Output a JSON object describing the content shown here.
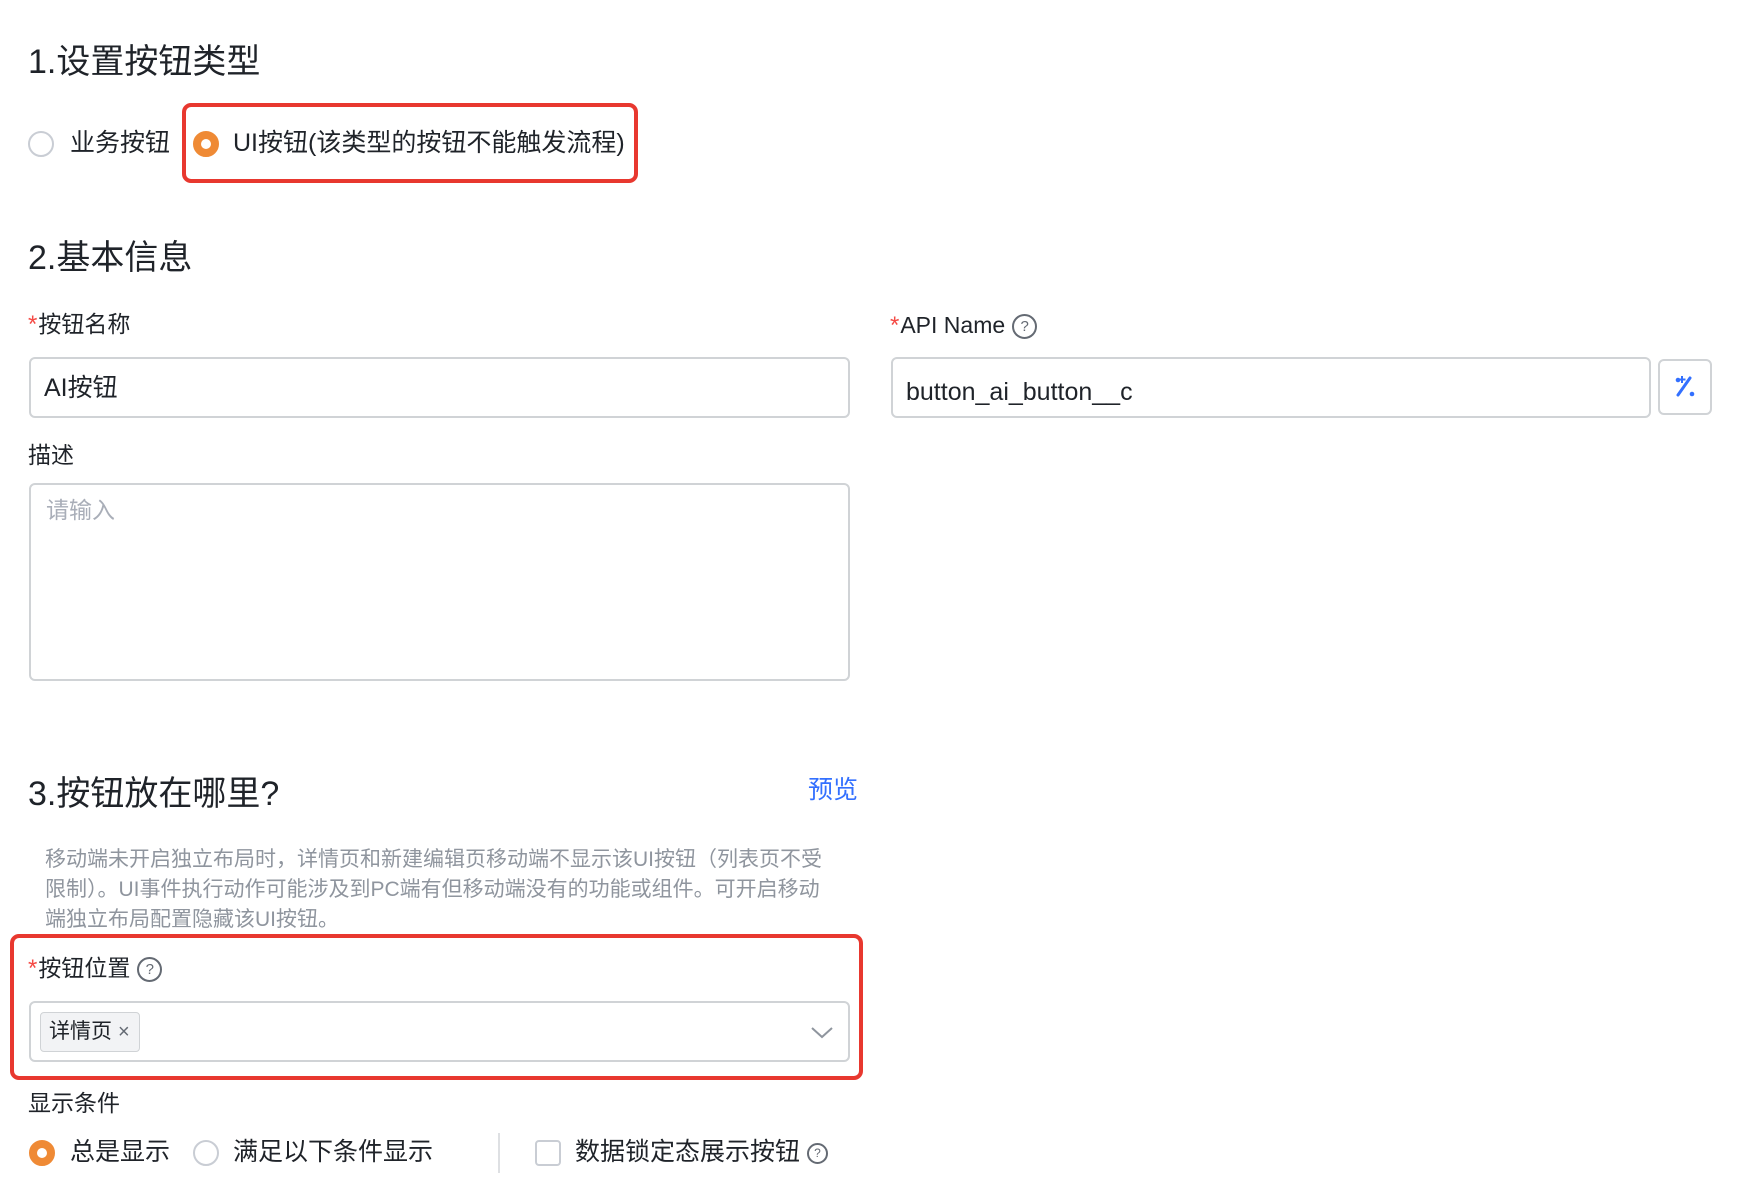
{
  "section1": {
    "title": "1.设置按钮类型",
    "options": [
      {
        "label": "业务按钮",
        "checked": false
      },
      {
        "label": "UI按钮(该类型的按钮不能触发流程)",
        "checked": true
      }
    ]
  },
  "section2": {
    "title": "2.基本信息",
    "name_field": {
      "required_mark": "*",
      "label": "按钮名称",
      "value": "AI按钮"
    },
    "api_field": {
      "required_mark": "*",
      "label": "API Name",
      "value": "button_ai_button__c",
      "help_icon": "question-circle-icon",
      "action_icon": "magic-wand-icon"
    },
    "desc_field": {
      "label": "描述",
      "placeholder": "请输入"
    }
  },
  "section3": {
    "title": "3.按钮放在哪里?",
    "preview_link": "预览",
    "hint": "移动端未开启独立布局时，详情页和新建编辑页移动端不显示该UI按钮（列表页不受限制）。UI事件执行动作可能涉及到PC端有但移动端没有的功能或组件。可开启移动端独立布局配置隐藏该UI按钮。",
    "position_field": {
      "required_mark": "*",
      "label": "按钮位置",
      "help_icon": "question-circle-icon",
      "tags": [
        "详情页"
      ],
      "tag_close": "×",
      "dropdown_icon": "chevron-down-icon"
    },
    "display_condition": {
      "label": "显示条件",
      "options": [
        {
          "label": "总是显示",
          "checked": true
        },
        {
          "label": "满足以下条件显示",
          "checked": false
        }
      ],
      "lock_checkbox": {
        "label": "数据锁定态展示按钮",
        "checked": false,
        "help_icon": "question-circle-icon"
      }
    }
  },
  "colors": {
    "accent": "#ef8a35",
    "link": "#3370ff",
    "highlight": "#e8382f",
    "required": "#f54a45"
  }
}
